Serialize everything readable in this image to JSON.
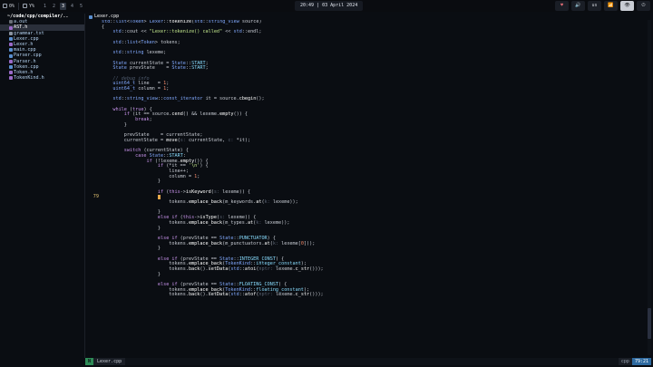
{
  "topbar": {
    "left_label": "0%",
    "left_label2": "Y%",
    "workspaces": [
      "1",
      "2",
      "3",
      "4",
      "5"
    ],
    "active_workspace": "3",
    "clock": "20:49 | 03 April 2024",
    "right_items": [
      "♥",
      "🔊",
      "us",
      "📶",
      "👁",
      "⏻"
    ]
  },
  "tree": {
    "title": "~/code/cpp/compiler/..",
    "items": [
      {
        "name": "a.out",
        "kind": "bin"
      },
      {
        "name": "AST.h",
        "kind": "h"
      },
      {
        "name": "grammar.txt",
        "kind": "txt"
      },
      {
        "name": "Lexer.cpp",
        "kind": "cpp"
      },
      {
        "name": "Lexer.h",
        "kind": "h"
      },
      {
        "name": "main.cpp",
        "kind": "cpp"
      },
      {
        "name": "Parser.cpp",
        "kind": "cpp"
      },
      {
        "name": "Parser.h",
        "kind": "h"
      },
      {
        "name": "Token.cpp",
        "kind": "cpp"
      },
      {
        "name": "Token.h",
        "kind": "h"
      },
      {
        "name": "TokenKind.h",
        "kind": "h"
      }
    ],
    "highlighted": "AST.h"
  },
  "editor": {
    "tab_title": "Lexer.cpp",
    "cursor_line_number": "79",
    "lines": [
      {
        "n": "",
        "html": "<span class=\"ty\">std</span>::<span class=\"ty\">list</span>&lt;<span class=\"ty\">Token</span>&gt; <span class=\"ty\">Lexer</span>::<span class=\"fn\">tokenize</span>(<span class=\"ty\">std</span>::<span class=\"ty\">string_view</span> source)"
      },
      {
        "n": "",
        "html": "{"
      },
      {
        "n": "",
        "html": "    <span class=\"ty\">std</span>::cout &lt;&lt; <span class=\"str\">\"Lexer::tokenize() called\"</span> &lt;&lt; <span class=\"ty\">std</span>::endl;"
      },
      {
        "n": "",
        "html": ""
      },
      {
        "n": "",
        "html": "    <span class=\"ty\">std</span>::<span class=\"ty\">list</span>&lt;<span class=\"ty\">Token</span>&gt; tokens;"
      },
      {
        "n": "",
        "html": ""
      },
      {
        "n": "",
        "html": "    <span class=\"ty\">std</span>::<span class=\"ty\">string</span> lexeme;"
      },
      {
        "n": "",
        "html": ""
      },
      {
        "n": "",
        "html": "    <span class=\"ty\">State</span> currentState = <span class=\"ty\">State</span>::<span class=\"ns\">START</span>;"
      },
      {
        "n": "",
        "html": "    <span class=\"ty\">State</span> prevState    = <span class=\"ty\">State</span>::<span class=\"ns\">START</span>;"
      },
      {
        "n": "",
        "html": ""
      },
      {
        "n": "",
        "html": "    <span class=\"com\">// debug info</span>"
      },
      {
        "n": "",
        "html": "    <span class=\"ty\">uint64_t</span> line   = <span class=\"num\">1</span>;"
      },
      {
        "n": "",
        "html": "    <span class=\"ty\">uint64_t</span> column = <span class=\"num\">1</span>;"
      },
      {
        "n": "",
        "html": ""
      },
      {
        "n": "",
        "html": "    <span class=\"ty\">std</span>::<span class=\"ty\">string_view</span>::<span class=\"ty\">const_iterator</span> it = source.<span class=\"fn\">cbegin</span>();"
      },
      {
        "n": "",
        "html": ""
      },
      {
        "n": "",
        "html": "    <span class=\"kw\">while</span> (<span class=\"kw\">true</span>) {"
      },
      {
        "n": "",
        "html": "        <span class=\"kw\">if</span> (it == source.<span class=\"fn\">cend</span>() &amp;&amp; lexeme.<span class=\"fn\">empty</span>()) {"
      },
      {
        "n": "",
        "html": "            <span class=\"kw\">break</span>;"
      },
      {
        "n": "",
        "html": "        }"
      },
      {
        "n": "",
        "html": ""
      },
      {
        "n": "",
        "html": "        prevState    = currentState;"
      },
      {
        "n": "",
        "html": "        currentState = <span class=\"fn\">move</span>(<span class=\"hint\">s:</span> currentState, <span class=\"hint\">c:</span> *it);"
      },
      {
        "n": "",
        "html": ""
      },
      {
        "n": "",
        "html": "        <span class=\"kw\">switch</span> (currentState) {"
      },
      {
        "n": "",
        "html": "            <span class=\"kw\">case</span> <span class=\"ty\">State</span>::<span class=\"ns\">START</span>:"
      },
      {
        "n": "",
        "html": "                <span class=\"kw\">if</span> (!lexeme.<span class=\"fn\">empty</span>()) {"
      },
      {
        "n": "",
        "html": "                    <span class=\"kw\">if</span> (*it == <span class=\"str\">'\\n'</span>) {"
      },
      {
        "n": "",
        "html": "                        line++;"
      },
      {
        "n": "",
        "html": "                        column = <span class=\"num\">1</span>;"
      },
      {
        "n": "",
        "html": "                    }"
      },
      {
        "n": "",
        "html": ""
      },
      {
        "n": "",
        "html": "                    <span class=\"kw\">if</span> (<span class=\"kw\">this</span>-&gt;<span class=\"fn\">isKeyword</span>(<span class=\"hint\">s:</span> lexeme)) {"
      },
      {
        "n": "79",
        "html": "                    <span class=\"cur-block\"></span>",
        "cursor": true
      },
      {
        "n": "",
        "html": "                        tokens.<span class=\"fn\">emplace_back</span>(m_keywords.<span class=\"fn\">at</span>(<span class=\"hint\">k:</span> lexeme));"
      },
      {
        "n": "",
        "html": ""
      },
      {
        "n": "",
        "html": "                    }"
      },
      {
        "n": "",
        "html": "                    <span class=\"kw\">else if</span> (<span class=\"kw\">this</span>-&gt;<span class=\"fn\">isType</span>(<span class=\"hint\">s:</span> lexeme)) {"
      },
      {
        "n": "",
        "html": "                        tokens.<span class=\"fn\">emplace_back</span>(m_types.<span class=\"fn\">at</span>(<span class=\"hint\">k:</span> lexeme));"
      },
      {
        "n": "",
        "html": "                    }"
      },
      {
        "n": "",
        "html": ""
      },
      {
        "n": "",
        "html": "                    <span class=\"kw\">else if</span> (prevState == <span class=\"ty\">State</span>::<span class=\"ns\">PUNCTUATOR</span>) {"
      },
      {
        "n": "",
        "html": "                        tokens.<span class=\"fn\">emplace_back</span>(m_punctuators.<span class=\"fn\">at</span>(<span class=\"hint\">k:</span> lexeme[<span class=\"num\">0</span>]));"
      },
      {
        "n": "",
        "html": "                    }"
      },
      {
        "n": "",
        "html": ""
      },
      {
        "n": "",
        "html": "                    <span class=\"kw\">else if</span> (prevState == <span class=\"ty\">State</span>::<span class=\"ns\">INTEGER_CONST</span>) {"
      },
      {
        "n": "",
        "html": "                        tokens.<span class=\"fn\">emplace_back</span>(<span class=\"ty\">TokenKind</span>::<span class=\"ns\">integer_constant</span>);"
      },
      {
        "n": "",
        "html": "                        tokens.<span class=\"fn\">back</span>().<span class=\"fn\">setData</span>(<span class=\"ty\">std</span>::<span class=\"fn\">atoi</span>(<span class=\"hint\">nptr:</span> lexeme.<span class=\"fn\">c_str</span>()));"
      },
      {
        "n": "",
        "html": "                    }"
      },
      {
        "n": "",
        "html": ""
      },
      {
        "n": "",
        "html": "                    <span class=\"kw\">else if</span> (prevState == <span class=\"ty\">State</span>::<span class=\"ns\">FLOATING_CONST</span>) {"
      },
      {
        "n": "",
        "html": "                        tokens.<span class=\"fn\">emplace_back</span>(<span class=\"ty\">TokenKind</span>::<span class=\"ns\">floating_constant</span>);"
      },
      {
        "n": "",
        "html": "                        tokens.<span class=\"fn\">back</span>().<span class=\"fn\">setData</span>(<span class=\"ty\">std</span>::<span class=\"fn\">atof</span>(<span class=\"hint\">nptr:</span> lexeme.<span class=\"fn\">c_str</span>()));"
      }
    ]
  },
  "statusbar": {
    "mode": "N",
    "filename": "Lexer.cpp",
    "filetype": "cpp",
    "position": "79:21"
  }
}
